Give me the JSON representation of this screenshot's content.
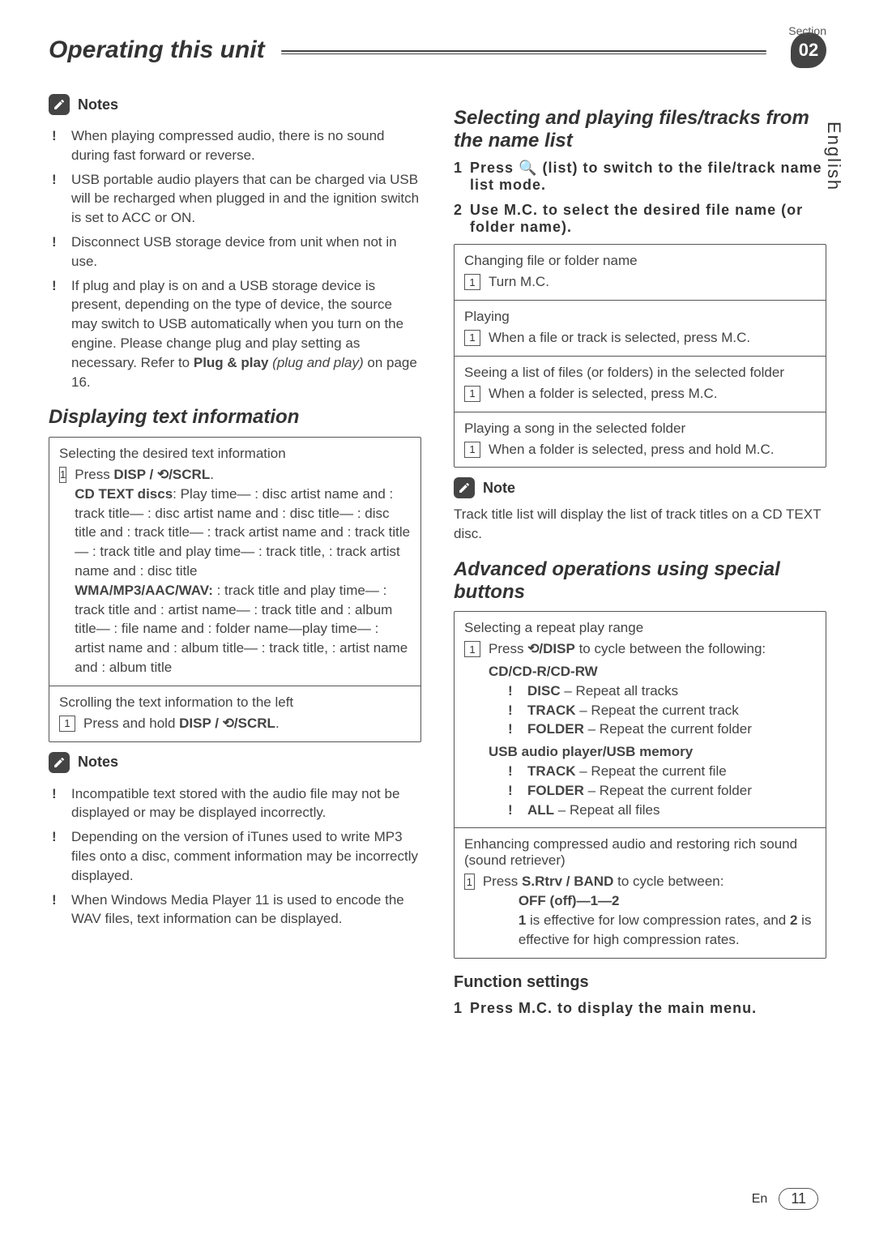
{
  "header": {
    "section_label": "Section",
    "section_number": "02",
    "title": "Operating this unit",
    "language_tab": "English"
  },
  "left": {
    "notes_label": "Notes",
    "notes1": [
      "When playing compressed audio, there is no sound during fast forward or reverse.",
      "USB portable audio players that can be charged via USB will be recharged when plugged in and the ignition switch is set to ACC or ON.",
      "Disconnect USB storage device from unit when not in use.",
      "If plug and play is on and a USB storage device is present, depending on the type of device, the source may switch to USB automatically when you turn on the engine. Please change plug and play setting as necessary. Refer to "
    ],
    "note4_bold": "Plug & play",
    "note4_ital": " (plug and play)",
    "note4_tail": " on page 16.",
    "h_text": "Displaying text information",
    "box1": {
      "t1": "Selecting the desired text information",
      "step1_prefix": "Press ",
      "step1_btn": "DISP / ⟲/SCRL",
      "step1_suffix": ".",
      "cd_label": "CD TEXT discs",
      "cd_body": ": Play time— : disc artist name and : track title— : disc artist name and : disc title— : disc title and : track title— : track artist name and : track title— : track title and play time— : track title, : track artist name and : disc title",
      "wma_label": "WMA/MP3/AAC/WAV:",
      "wma_body": " : track title and play time— : track title and : artist name— : track title and : album title— : file name and : folder name—play time— : artist name and : album title— : track title, : artist name and : album title",
      "t2": "Scrolling the text information to the left",
      "step2_prefix": "Press and hold ",
      "step2_btn": "DISP / ⟲/SCRL",
      "step2_suffix": "."
    },
    "notes2_label": "Notes",
    "notes2": [
      "Incompatible text stored with the audio file may not be displayed or may be displayed incorrectly.",
      "Depending on the version of iTunes used to write MP3 files onto a disc, comment information may be incorrectly displayed.",
      "When Windows Media Player 11 is used to encode the WAV files, text information can be displayed."
    ]
  },
  "right": {
    "h1": "Selecting and playing files/tracks from the name list",
    "s1_num": "1",
    "s1_text": "Press  🔍 (list) to switch to the file/track name list mode.",
    "s2_num": "2",
    "s2_text": "Use M.C. to select the desired file name (or folder name).",
    "box_file": {
      "c1_title": "Changing file or folder name",
      "c1_step": "Turn M.C.",
      "c2_title": "Playing",
      "c2_step": "When a file or track is selected, press M.C.",
      "c3_title": "Seeing a list of files (or folders) in the selected folder",
      "c3_step": "When a folder is selected, press M.C.",
      "c4_title": "Playing a song in the selected folder",
      "c4_step": "When a folder is selected, press and hold M.C."
    },
    "note_label": "Note",
    "note_body": "Track title list will display the list of track titles on a CD TEXT disc.",
    "h2": "Advanced operations using special buttons",
    "box_adv": {
      "r1_title": "Selecting a repeat play range",
      "r1_step_prefix": "Press ",
      "r1_step_btn": "⟲/DISP",
      "r1_step_suffix": " to cycle between the following:",
      "cd_hdr": "CD/CD-R/CD-RW",
      "cd_items": [
        {
          "k": "DISC",
          "v": "– Repeat all tracks"
        },
        {
          "k": "TRACK",
          "v": "– Repeat the current track"
        },
        {
          "k": "FOLDER",
          "v": "– Repeat the current folder"
        }
      ],
      "usb_hdr": "USB audio player/USB memory",
      "usb_items": [
        {
          "k": "TRACK",
          "v": "– Repeat the current file"
        },
        {
          "k": "FOLDER",
          "v": "– Repeat the current folder"
        },
        {
          "k": "ALL",
          "v": "– Repeat all files"
        }
      ],
      "r2_title": "Enhancing compressed audio and restoring rich sound (sound retriever)",
      "r2_step_prefix": "Press ",
      "r2_step_btn": "S.Rtrv / BAND",
      "r2_step_suffix": " to cycle between:",
      "r2_opts_pre": "OFF (off)—",
      "r2_opts_1": "1",
      "r2_opts_mid": "—",
      "r2_opts_2": "2",
      "r2_foot_a": "1",
      "r2_foot_mid": " is effective for low compression rates, and ",
      "r2_foot_b": "2",
      "r2_foot_tail": " is effective for high compression rates."
    },
    "h3": "Function settings",
    "fs_num": "1",
    "fs_text": "Press M.C. to display the main menu."
  },
  "footer": {
    "lang_short": "En",
    "page": "11"
  }
}
